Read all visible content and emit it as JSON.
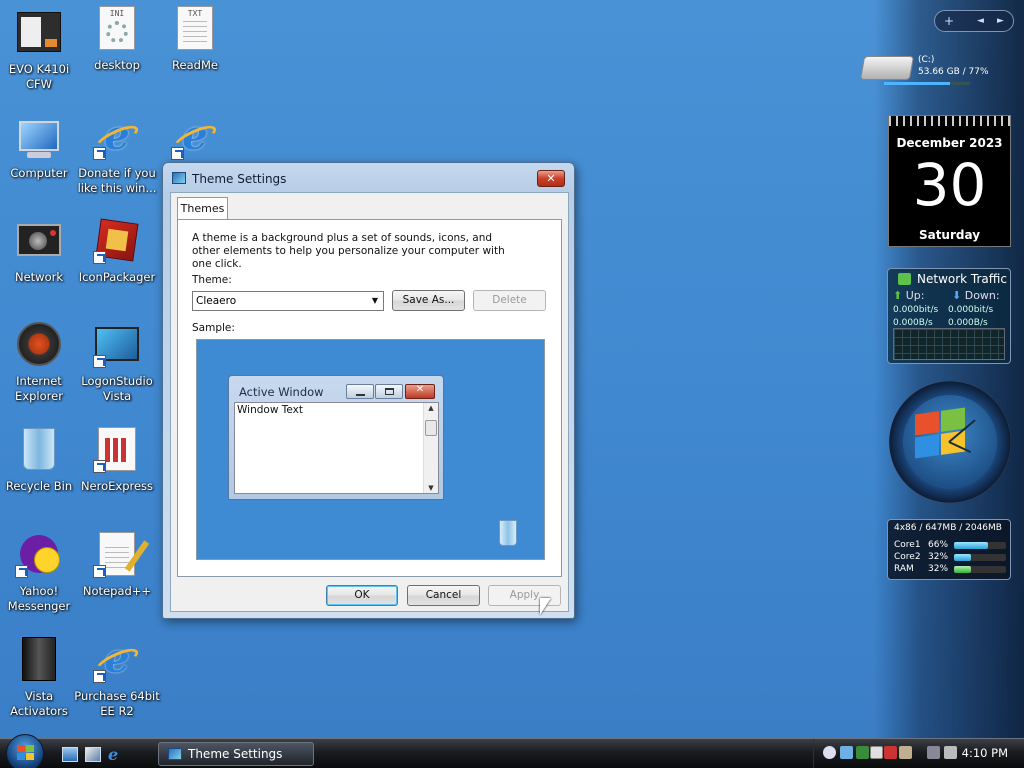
{
  "desktop_icons": [
    {
      "label": "EVO K410i CFW",
      "icon": "book-icon"
    },
    {
      "label": "desktop",
      "icon": "ini-file-icon",
      "tag": "INI"
    },
    {
      "label": "ReadMe",
      "icon": "text-file-icon",
      "tag": "TXT"
    },
    {
      "label": "Computer",
      "icon": "computer-icon"
    },
    {
      "label": "Donate if you like this win...",
      "icon": "ie-icon"
    },
    {
      "label": "",
      "icon": "ie-icon"
    },
    {
      "label": "Network",
      "icon": "network-icon"
    },
    {
      "label": "IconPackager",
      "icon": "iconpackager-icon"
    },
    {
      "label": "Internet Explorer",
      "icon": "ie-alt-icon"
    },
    {
      "label": "LogonStudio Vista",
      "icon": "logonstudio-icon"
    },
    {
      "label": "Recycle Bin",
      "icon": "recycle-bin-icon"
    },
    {
      "label": "NeroExpress",
      "icon": "nero-icon"
    },
    {
      "label": "Yahoo! Messenger",
      "icon": "yahoo-messenger-icon"
    },
    {
      "label": "Notepad++",
      "icon": "notepad-plus-icon"
    },
    {
      "label": "Vista Activators",
      "icon": "folder-icon"
    },
    {
      "label": "Purchase 64bit EE R2",
      "icon": "ie-icon"
    }
  ],
  "dialog": {
    "title": "Theme Settings",
    "close_label": "✕",
    "tab": "Themes",
    "description": "A theme is a background plus a set of sounds, icons, and other elements to help you personalize your computer with one click.",
    "theme_label": "Theme:",
    "theme_value": "Cleaero",
    "save_as_label": "Save As...",
    "delete_label": "Delete",
    "sample_label": "Sample:",
    "sample_window_title": "Active Window",
    "sample_window_text": "Window Text",
    "ok_label": "OK",
    "cancel_label": "Cancel",
    "apply_label": "Apply"
  },
  "sidebar": {
    "controls": {
      "add": "+",
      "prev": "◄",
      "next": "►"
    },
    "drive": {
      "name": "(C:)",
      "info": "53.66 GB / 77%",
      "used_fraction": 0.77
    },
    "calendar": {
      "month": "December 2023",
      "day": "30",
      "weekday": "Saturday"
    },
    "network": {
      "title": "Network Traffic",
      "up_label": "Up:",
      "down_label": "Down:",
      "up_bits": "0.000bit/s",
      "down_bits": "0.000bit/s",
      "up_bytes": "0.000B/s",
      "down_bytes": "0.000B/s"
    },
    "sysmon": {
      "header": "4x86 / 647MB / 2046MB",
      "rows": [
        {
          "name": "Core1",
          "percent": "66%",
          "value": 0.66
        },
        {
          "name": "Core2",
          "percent": "32%",
          "value": 0.32
        },
        {
          "name": "RAM",
          "percent": "32%",
          "value": 0.32
        }
      ]
    }
  },
  "taskbar": {
    "task_label": "Theme Settings",
    "time": "4:10 PM"
  }
}
